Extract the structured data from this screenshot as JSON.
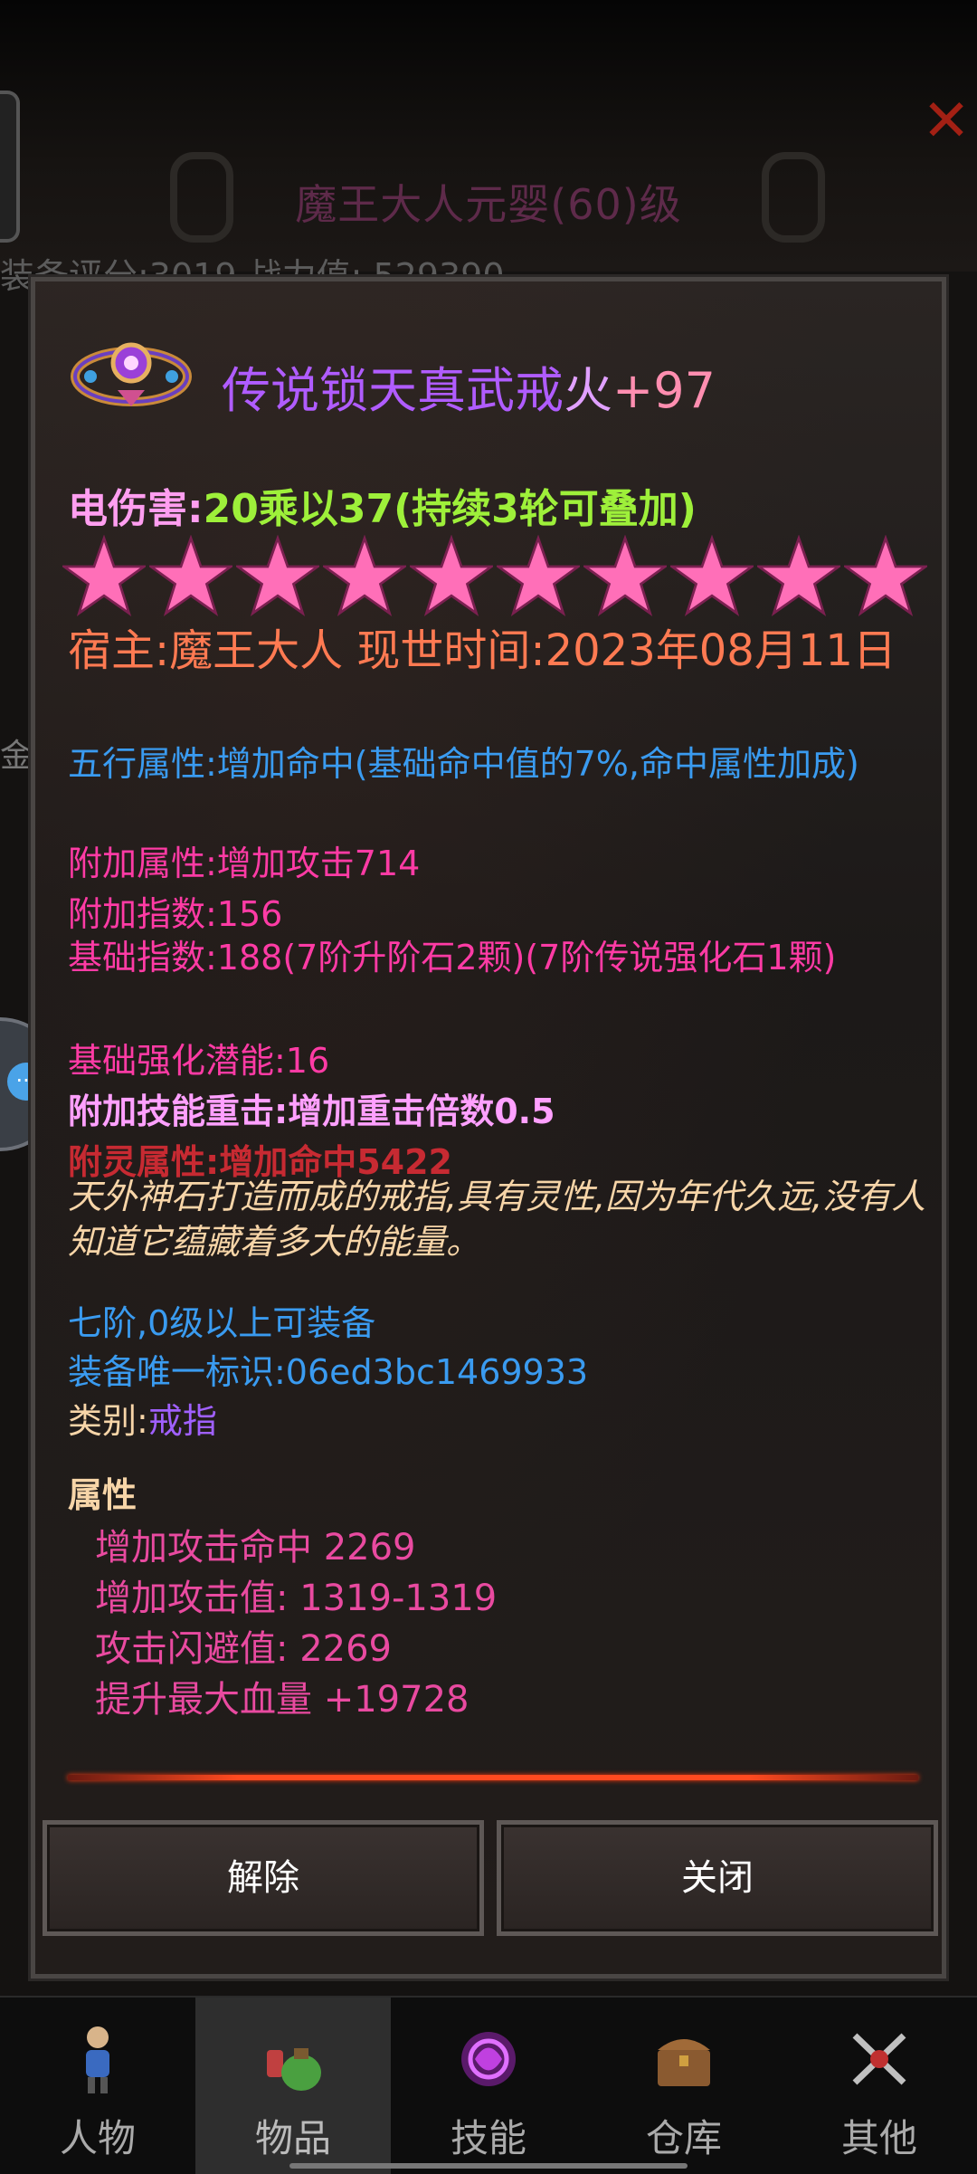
{
  "background": {
    "title": "魔王大人元婴(60)级",
    "score_text": "装备评分:3019 战力值: 529390",
    "side_label": "金"
  },
  "item": {
    "name_part1": "传说锁天真武戒",
    "name_part2": "火",
    "name_part3": "+97",
    "damage_label": "电伤害:",
    "damage_value": "20乘以37(持续3轮可叠加)",
    "star_count": 10,
    "host_text": "宿主:魔王大人 现世时间:2023年08月11日",
    "wuxing_text": "五行属性:增加命中(基础命中值的7%,命中属性加成)",
    "extra_attr": "附加属性:增加攻击714",
    "extra_index": "附加指数:156",
    "base_index": "基础指数:188(7阶升阶石2颗)(7阶传说强化石1颗)",
    "potential": "基础强化潜能:16",
    "skill_crit": "附加技能重击:增加重击倍数0.5",
    "spirit_attr": "附灵属性:增加命中5422",
    "description": "天外神石打造而成的戒指,具有灵性,因为年代久远,没有人知道它蕴藏着多大的能量。",
    "requirement": "七阶,0级以上可装备",
    "uid": "装备唯一标识:06ed3bc1469933",
    "category_label": "类别:",
    "category_value": "戒指",
    "attributes_header": "属性",
    "attributes": [
      "增加攻击命中 2269",
      "增加攻击值: 1319-1319",
      "攻击闪避值: 2269",
      "提升最大血量 +19728"
    ]
  },
  "buttons": {
    "remove": "解除",
    "close": "关闭"
  },
  "nav": [
    {
      "label": "人物",
      "icon": "character-icon"
    },
    {
      "label": "物品",
      "icon": "potion-bag-icon",
      "active": true
    },
    {
      "label": "技能",
      "icon": "skill-orb-icon"
    },
    {
      "label": "仓库",
      "icon": "chest-icon"
    },
    {
      "label": "其他",
      "icon": "crossed-swords-icon"
    }
  ],
  "colors": {
    "star": "#ff6fb8",
    "host": "#ff7a52",
    "blue": "#3a9bf0",
    "pink": "#ff3ba5",
    "divider": "#ff4a20"
  }
}
